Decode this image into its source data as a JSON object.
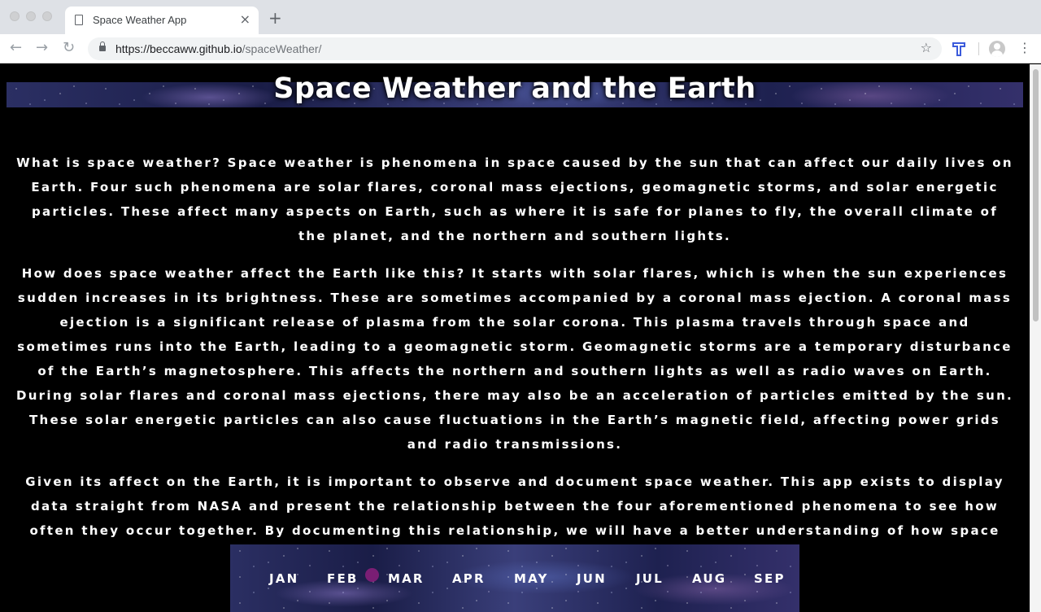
{
  "browser": {
    "tab_title": "Space Weather App",
    "tab_close": "×",
    "new_tab": "+",
    "back": "←",
    "forward": "→",
    "reload": "↻",
    "url_host": "https://beccaww.github.io",
    "url_path": "/spaceWeather/",
    "bookmark": "☆",
    "menu": "⋮"
  },
  "page": {
    "title": "Space Weather and the Earth",
    "paragraphs": [
      "What is space weather? Space weather is phenomena in space caused by the sun that can affect our daily lives on Earth. Four such phenomena are solar flares, coronal mass ejections, geomagnetic storms, and solar energetic particles. These affect many aspects on Earth, such as where it is safe for planes to fly, the overall climate of the planet, and the northern and southern lights.",
      "How does space weather affect the Earth like this? It starts with solar flares, which is when the sun experiences sudden increases in its brightness. These are sometimes accompanied by a coronal mass ejection. A coronal mass ejection is a significant release of plasma from the solar corona. This plasma travels through space and sometimes runs into the Earth, leading to a geomagnetic storm. Geomagnetic storms are a temporary disturbance of the Earth’s magnetosphere. This affects the northern and southern lights as well as radio waves on Earth. During solar flares and coronal mass ejections, there may also be an acceleration of particles emitted by the sun. These solar energetic particles can also cause fluctuations in the Earth’s magnetic field, affecting power grids and radio transmissions.",
      "Given its affect on the Earth, it is important to observe and document space weather. This app exists to display data straight from NASA and present the relationship between the four aforementioned phenomena to see how often they occur together. By documenting this relationship, we will have a better understanding of how space weather works."
    ],
    "months": [
      "JAN",
      "FEB",
      "MAR",
      "APR",
      "MAY",
      "JUN",
      "JUL",
      "AUG",
      "SEP"
    ],
    "marker_color": "#7a1e74"
  }
}
